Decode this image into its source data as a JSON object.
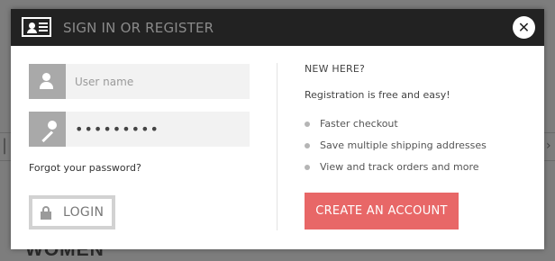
{
  "background": {
    "heading": "WOMEN"
  },
  "modal": {
    "title": "SIGN IN OR REGISTER",
    "close_glyph": "✕",
    "header_icon": "id-card-icon"
  },
  "login_form": {
    "username": {
      "placeholder": "User name",
      "icon": "user-icon"
    },
    "password": {
      "value": "•••••••••",
      "icon": "key-icon"
    },
    "forgot_password": "Forgot your password?",
    "login_button": {
      "label": "LOGIN",
      "icon": "lock-icon"
    }
  },
  "register": {
    "heading": "NEW HERE?",
    "subtitle": "Registration is free and easy!",
    "benefits": [
      "Faster checkout",
      "Save multiple shipping addresses",
      "View and track orders and more"
    ],
    "create_button": "CREATE AN ACCOUNT"
  },
  "colors": {
    "header_bg": "#222222",
    "accent": "#e86767",
    "field_bg": "#f2f2f2",
    "icon_bg": "#a9a9a9"
  }
}
